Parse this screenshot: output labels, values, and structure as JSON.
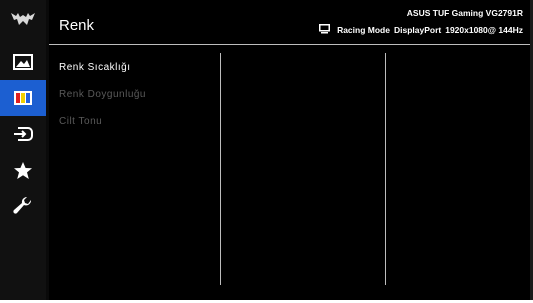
{
  "header": {
    "title": "Renk",
    "model": "ASUS TUF Gaming  VG2791R",
    "mode": "Racing Mode",
    "input": "DisplayPort",
    "resolution": "1920x1080@ 144Hz"
  },
  "sidebar": {
    "items": [
      {
        "icon": "image-icon",
        "active": false
      },
      {
        "icon": "color-bars-icon",
        "active": true
      },
      {
        "icon": "input-select-icon",
        "active": false
      },
      {
        "icon": "star-icon",
        "active": false
      },
      {
        "icon": "wrench-icon",
        "active": false
      }
    ]
  },
  "menu": {
    "items": [
      {
        "label": "Renk Sıcaklığı",
        "state": "active"
      },
      {
        "label": "Renk Doygunluğu",
        "state": "disabled"
      },
      {
        "label": "Cilt Tonu",
        "state": "disabled"
      }
    ]
  },
  "colors": {
    "accent": "#1c5fd1",
    "background": "#000000",
    "divider": "#bdbdbd",
    "disabled_text": "#5a5a5a"
  }
}
